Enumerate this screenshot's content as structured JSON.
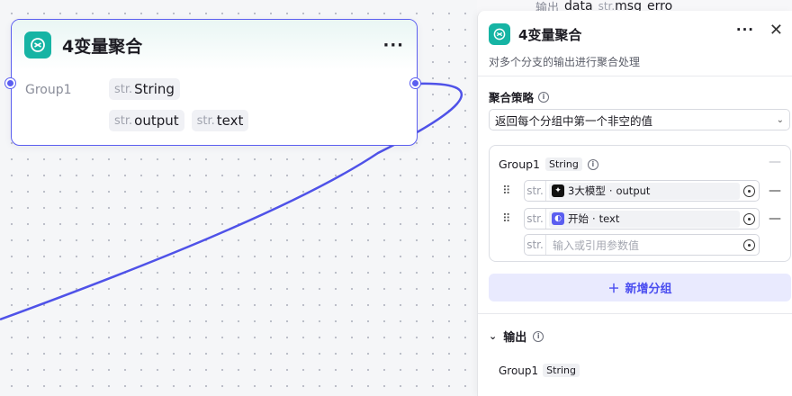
{
  "node": {
    "title": "4变量聚合",
    "more": "···",
    "group_label": "Group1",
    "group_type": {
      "prefix": "str.",
      "name": "String"
    },
    "inputs": [
      {
        "prefix": "str.",
        "name": "output"
      },
      {
        "prefix": "str.",
        "name": "text"
      }
    ]
  },
  "top_strip": {
    "label": "输出",
    "tags": [
      {
        "prefix": "",
        "name": "data"
      },
      {
        "prefix": "str.",
        "name": "msg"
      },
      {
        "prefix": "",
        "name": "erro"
      }
    ]
  },
  "panel": {
    "title": "4变量聚合",
    "more": "···",
    "close": "✕",
    "description": "对多个分支的输出进行聚合处理",
    "strategy_label": "聚合策略",
    "strategy_value": "返回每个分组中第一个非空的值",
    "group": {
      "name": "Group1",
      "type": "String",
      "rows": [
        {
          "prefix": "str.",
          "source": "3大模型",
          "field": "output"
        },
        {
          "prefix": "str.",
          "source": "开始",
          "field": "text"
        }
      ],
      "empty_prefix": "str.",
      "empty_placeholder": "输入或引用参数值"
    },
    "add_group_label": "新增分组",
    "output_label": "输出",
    "output_item": {
      "name": "Group1",
      "type": "String"
    }
  },
  "colors": {
    "accent": "#5b5ef0",
    "node_icon": "#16b4a4"
  }
}
